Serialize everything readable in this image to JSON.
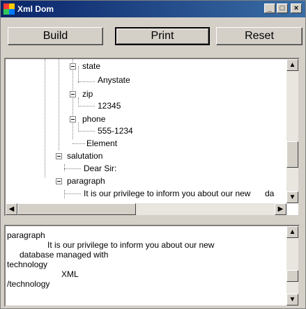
{
  "window": {
    "title": "Xml Dom",
    "minimize": "_",
    "maximize": "□",
    "close": "×"
  },
  "toolbar": {
    "build_label": "Build",
    "print_label": "Print",
    "reset_label": "Reset"
  },
  "tree": {
    "nodes": [
      {
        "label": "state"
      },
      {
        "label": "Anystate"
      },
      {
        "label": "zip"
      },
      {
        "label": "12345"
      },
      {
        "label": "phone"
      },
      {
        "label": "555-1234"
      },
      {
        "label": "Element"
      },
      {
        "label": "salutation"
      },
      {
        "label": "Dear Sir:"
      },
      {
        "label": "paragraph"
      },
      {
        "label": "It is our privilege to inform you about our new"
      },
      {
        "label": "da"
      }
    ]
  },
  "output": {
    "lines": [
      "paragraph",
      "It is our privilege to inform you about our new",
      "database managed with",
      "technology",
      "XML",
      "/technology"
    ]
  },
  "icons": {
    "app": "app-icon",
    "up": "up-arrow-icon",
    "down": "down-arrow-icon",
    "left": "left-arrow-icon",
    "right": "right-arrow-icon"
  },
  "colors": {
    "titlebar_start": "#0a246a",
    "titlebar_end": "#3a6ea5",
    "face": "#d4d0c8"
  }
}
